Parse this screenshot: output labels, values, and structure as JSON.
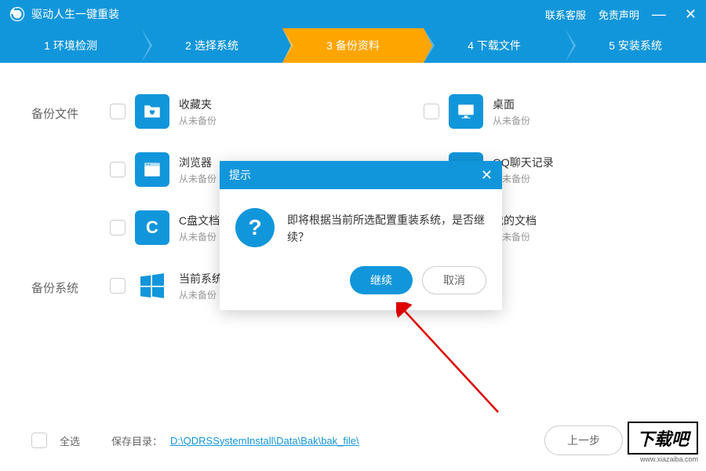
{
  "titlebar": {
    "title": "驱动人生一键重装",
    "contact": "联系客服",
    "disclaimer": "免责声明"
  },
  "steps": [
    "1 环境检测",
    "2 选择系统",
    "3 备份资料",
    "4 下载文件",
    "5 安装系统"
  ],
  "sections": {
    "backup_files": "备份文件",
    "backup_system": "备份系统"
  },
  "items": {
    "favorites": {
      "name": "收藏夹",
      "status": "从未备份"
    },
    "desktop": {
      "name": "桌面",
      "status": "从未备份"
    },
    "browser": {
      "name": "浏览器",
      "status": "从未备份"
    },
    "qq": {
      "name": "QQ聊天记录",
      "status": "从未备份"
    },
    "cdisk": {
      "name": "C盘文档",
      "status": "从未备份"
    },
    "mydocs": {
      "name": "我的文档",
      "status": "从未备份"
    },
    "current_system": {
      "name": "当前系统",
      "status": "从未备份"
    }
  },
  "footer": {
    "select_all": "全选",
    "save_dir_label": "保存目录：",
    "save_dir_path": "D:\\QDRSSystemInstall\\Data\\Bak\\bak_file\\",
    "prev": "上一步"
  },
  "dialog": {
    "title": "提示",
    "message": "即将根据当前所选配置重装系统，是否继续？",
    "continue": "继续",
    "cancel": "取消"
  },
  "watermark": {
    "text": "下载吧",
    "url": "www.xiazaiba.com"
  }
}
